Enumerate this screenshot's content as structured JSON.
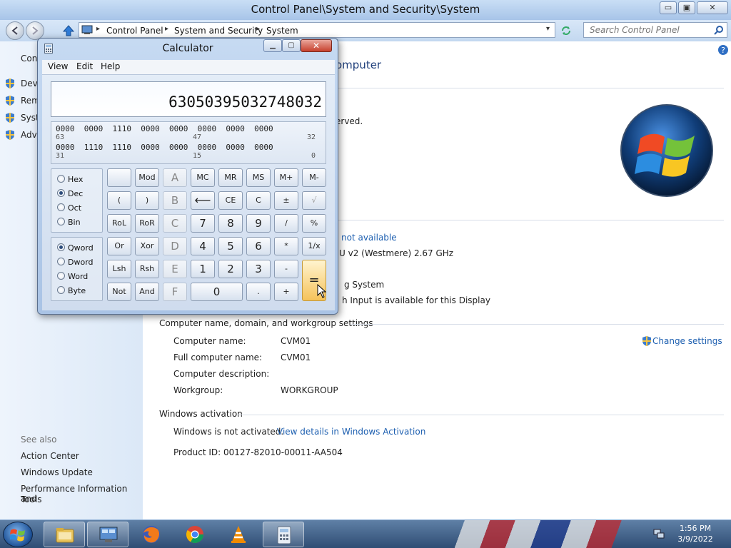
{
  "window": {
    "title": "Control Panel\\System and Security\\System",
    "minimize": "▭",
    "maximize": "▣",
    "close": "✕"
  },
  "address": {
    "crumbs": [
      "Control Panel",
      "System and Security",
      "System"
    ],
    "search_placeholder": "Search Control Panel"
  },
  "left_pane": {
    "top_partial": "Con",
    "items": [
      "Devi",
      "Rem",
      "Syst",
      "Adva"
    ],
    "see_also_label": "See also",
    "see_also": [
      "Action Center",
      "Windows Update",
      "Performance Information and",
      "Tools"
    ]
  },
  "main": {
    "heading_partial": "omputer",
    "reserved_partial": "erved.",
    "pen_touch_value_partial": "not available",
    "processor_partial": "U v2 (Westmere)   2.67 GHz",
    "system_type_partial": "g System",
    "pen_touch_partial": "h Input is available for this Display",
    "computer_section": "Computer name, domain, and workgroup settings",
    "change_settings": "Change settings",
    "rows": [
      {
        "label": "Computer name:",
        "value": "CVM01"
      },
      {
        "label": "Full computer name:",
        "value": "CVM01"
      },
      {
        "label": "Computer description:",
        "value": ""
      },
      {
        "label": "Workgroup:",
        "value": "WORKGROUP"
      }
    ],
    "activation_section": "Windows activation",
    "activation_status": "Windows is not activated.",
    "activation_link": "View details in Windows Activation",
    "product_id": "Product ID: 00127-82010-00011-AA504"
  },
  "calculator": {
    "title": "Calculator",
    "close": "✕",
    "menu": [
      "View",
      "Edit",
      "Help"
    ],
    "display": "63050395032748032",
    "binary": {
      "row1": "0000  0000  1110  0000  0000  0000  0000  0000",
      "row1_idx": [
        "63",
        "47",
        "32"
      ],
      "row2": "0000  1110  1110  0000  0000  0000  0000  0000",
      "row2_idx": [
        "31",
        "15",
        "0"
      ]
    },
    "radix": {
      "options": [
        "Hex",
        "Dec",
        "Oct",
        "Bin"
      ],
      "selected": "Dec"
    },
    "word_size": {
      "options": [
        "Qword",
        "Dword",
        "Word",
        "Byte"
      ],
      "selected": "Qword"
    },
    "keys": {
      "r1": [
        "",
        "Mod",
        "A",
        "MC",
        "MR",
        "MS",
        "M+",
        "M-"
      ],
      "r2": [
        "(",
        ")",
        "B",
        "⟵",
        "CE",
        "C",
        "±",
        "√"
      ],
      "r3": [
        "RoL",
        "RoR",
        "C",
        "7",
        "8",
        "9",
        "/",
        "%"
      ],
      "r4": [
        "Or",
        "Xor",
        "D",
        "4",
        "5",
        "6",
        "*",
        "1/x"
      ],
      "r5": [
        "Lsh",
        "Rsh",
        "E",
        "1",
        "2",
        "3",
        "-"
      ],
      "r6": [
        "Not",
        "And",
        "F",
        "0",
        ".",
        "+"
      ],
      "equals": "="
    }
  },
  "taskbar": {
    "apps": [
      "explorer",
      "control-panel",
      "firefox",
      "chrome",
      "vlc",
      "calculator"
    ],
    "time": "1:56 PM",
    "date": "3/9/2022"
  },
  "colors": {
    "accent": "#1d5fb0",
    "taskbar": "#2f4d74",
    "equals": "#f5c25a"
  }
}
